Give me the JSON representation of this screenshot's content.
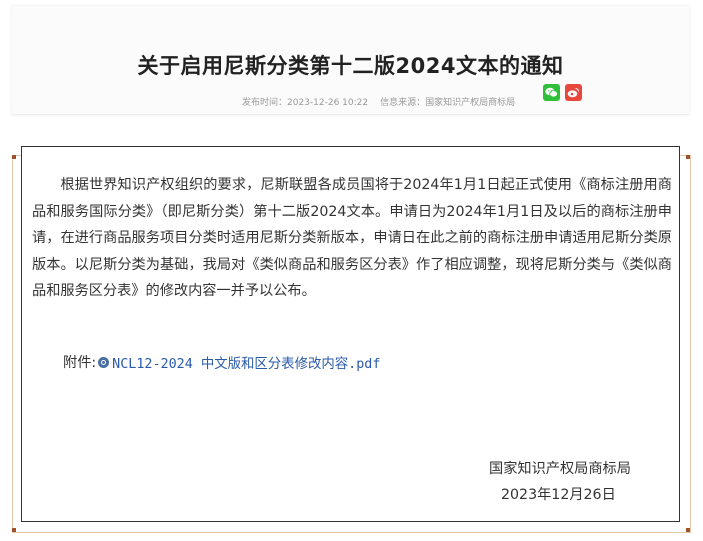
{
  "article": {
    "title": "关于启用尼斯分类第十二版2024文本的通知",
    "publish_label": "发布时间：",
    "publish_time": "2023-12-26 10:22",
    "source_label": "信息来源：",
    "source": "国家知识产权局商标局",
    "share": [
      {
        "name": "wechat-share-icon",
        "color": "#2fbf3a"
      },
      {
        "name": "weibo-share-icon",
        "color": "#e8473c"
      }
    ]
  },
  "document": {
    "paragraph": "根据世界知识产权组织的要求，尼斯联盟各成员国将于2024年1月1日起正式使用《商标注册用商品和服务国际分类》（即尼斯分类）第十二版2024文本。申请日为2024年1月1日及以后的商标注册申请，在进行商品服务项目分类时适用尼斯分类新版本，申请日在此之前的商标注册申请适用尼斯分类原版本。以尼斯分类为基础，我局对《类似商品和服务区分表》作了相应调整，现将尼斯分类与《类似商品和服务区分表》的修改内容一并予以公布。",
    "attachment_label": "附件:",
    "attachment_icon": "attachment-link-icon",
    "attachment_file": "NCL12-2024 中文版和区分表修改内容.pdf",
    "signature_org": "国家知识产权局商标局",
    "signature_date": "2023年12月26日"
  }
}
